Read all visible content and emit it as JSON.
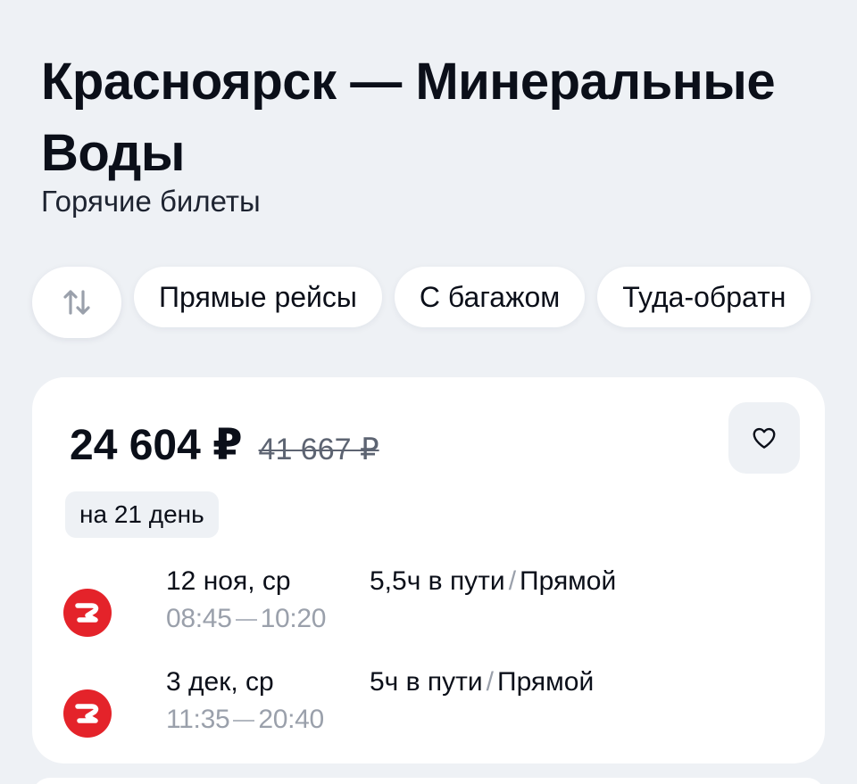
{
  "header": {
    "title": "Красноярск — Минеральные Воды",
    "subtitle": "Горячие билеты"
  },
  "filters": {
    "sort_icon": "sort-arrows-icon",
    "chips": [
      "Прямые рейсы",
      "С багажом",
      "Туда-обратн"
    ]
  },
  "ticket": {
    "price": "24 604 ₽",
    "old_price": "41 667 ₽",
    "duration_badge": "на 21 день",
    "favorite_icon": "heart-icon",
    "segments": [
      {
        "airline_icon": "airline-logo-icon",
        "date": "12 ноя, ср",
        "depart": "08:45",
        "arrive": "10:20",
        "travel_time": "5,5ч в пути",
        "type": "Прямой"
      },
      {
        "airline_icon": "airline-logo-icon",
        "date": "3 дек, ср",
        "depart": "11:35",
        "arrive": "20:40",
        "travel_time": "5ч в пути",
        "type": "Прямой"
      }
    ]
  },
  "colors": {
    "background": "#eef1f5",
    "card": "#ffffff",
    "airline_red": "#e4232a",
    "muted_text": "#9aa0ab"
  }
}
